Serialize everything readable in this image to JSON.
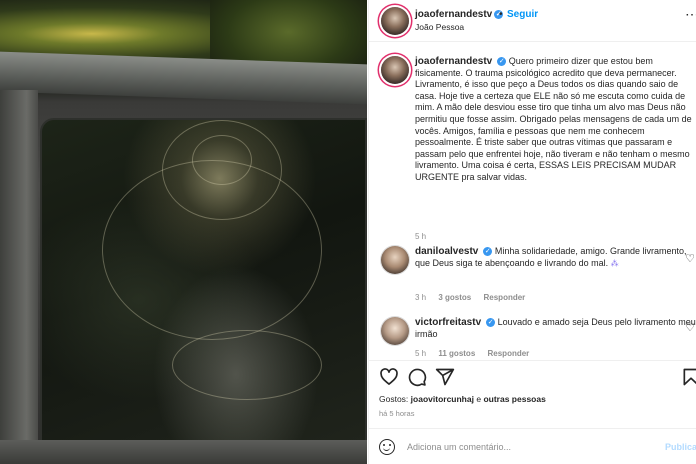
{
  "header": {
    "username": "joaofernandestv",
    "follow_label": "Seguir",
    "location": "João Pessoa",
    "separator": "•"
  },
  "caption": {
    "username": "joaofernandestv",
    "text": "Quero primeiro dizer que estou bem fisicamente. O trauma psicológico acredito que deva permanecer. Livramento, é isso que peço a Deus todos os dias quando saio de casa. Hoje tive a certeza que ELE não só me escuta como cuida de mim. A mão dele desviou esse tiro que tinha um alvo mas Deus não permitiu que fosse assim. Obrigado pelas mensagens de cada um de vocês. Amigos, família e pessoas que nem me conhecem pessoalmente. É triste saber que outras vítimas que passaram e passam pelo que enfrentei hoje, não tiveram e não tenham o mesmo livramento. Uma coisa é certa, ESSAS LEIS PRECISAM MUDAR URGENTE pra salvar vidas.",
    "time": "5 h"
  },
  "comments": [
    {
      "username": "daniloalvestv",
      "text": "Minha solidariedade, amigo. Grande livramento, que Deus siga te abençoando e livrando do mal.",
      "time": "3 h",
      "likes": "3 gostos",
      "reply": "Responder"
    },
    {
      "username": "victorfreitastv",
      "text": "Louvado e amado seja Deus pelo livramento meu irmão",
      "time": "5 h",
      "likes": "11 gostos",
      "reply": "Responder"
    }
  ],
  "likes": {
    "prefix": "Gostos:",
    "user": "joaovitorcunhaj",
    "connector": "e",
    "others": "outras pessoas"
  },
  "post_time": "há 5 horas",
  "comment_box": {
    "placeholder": "Adiciona um comentário...",
    "post_label": "Publicar"
  },
  "icons": {
    "verified": "verified-badge",
    "heart": "heart-icon",
    "comment": "comment-icon",
    "share": "share-icon",
    "save": "bookmark-icon",
    "emoji": "emoji-icon",
    "more": "more-icon"
  },
  "colors": {
    "accent": "#0095f6",
    "verified": "#3897f0",
    "muted": "#8e8e8e",
    "text": "#262626"
  }
}
